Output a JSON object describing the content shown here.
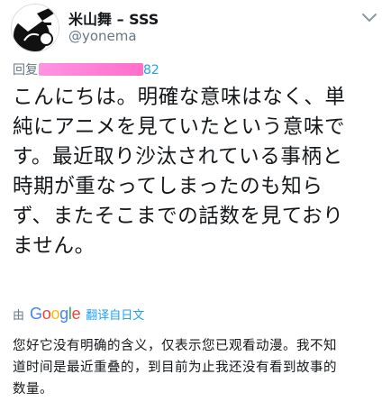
{
  "user": {
    "display_name": "米山舞 – SSS",
    "handle": "@yonema",
    "avatar_icon": "avatar-illustration",
    "menu_icon": "chevron-down-icon"
  },
  "reply": {
    "prefix": "回复",
    "tail": "82"
  },
  "tweet": {
    "lines": [
      "こんにちは。明確な意味はなく、単",
      "純にアニメを見ていたという意味で",
      "す。最近取り沙汰されている事柄と",
      "時期が重なってしまったのも知ら",
      "ず、またそこまでの話数を見ており",
      "ません。"
    ]
  },
  "translate": {
    "by": "由",
    "provider": "Google",
    "label": "翻译自日文"
  },
  "translation": {
    "lines": [
      "您好它没有明确的含义，仅表示您已观看动漫。我不知",
      "道时间是最近重叠的，到目前为止我还没有看到故事的",
      "数量。"
    ]
  },
  "colors": {
    "link": "#1da1f2",
    "muted": "#657786",
    "text": "#14171a",
    "redaction": "#ff3fb8"
  }
}
